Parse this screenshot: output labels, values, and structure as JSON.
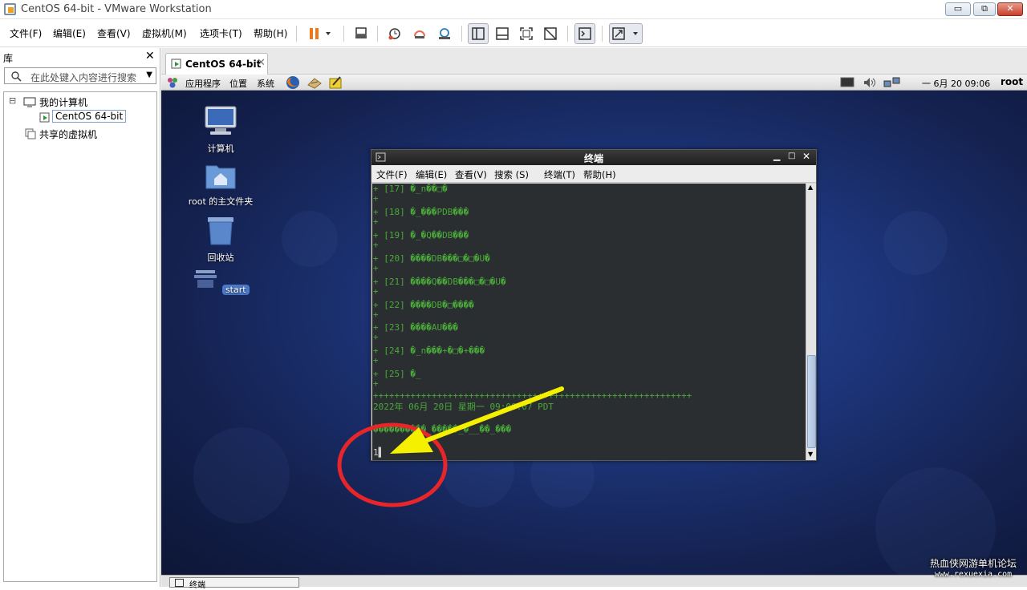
{
  "window": {
    "title": "CentOS 64-bit - VMware Workstation",
    "min_label": "▭",
    "max_label": "⧉",
    "close_label": "✕"
  },
  "menubar": {
    "items": [
      "文件(F)",
      "编辑(E)",
      "查看(V)",
      "虚拟机(M)",
      "选项卡(T)",
      "帮助(H)"
    ]
  },
  "library": {
    "header": "库",
    "close_label": "✕",
    "search_placeholder": "在此处键入内容进行搜索",
    "tree": {
      "my_computer": "我的计算机",
      "vm": "CentOS 64-bit",
      "shared": "共享的虚拟机",
      "expand_glyph": "⊟"
    }
  },
  "tab": {
    "label": "CentOS 64-bit",
    "close": "✕"
  },
  "gnome_panel": {
    "menus": [
      "应用程序",
      "位置",
      "系统"
    ],
    "clock": "一 6月 20 09:06",
    "user": "root"
  },
  "desktop": {
    "icons": [
      "计算机",
      "root 的主文件夹",
      "回收站",
      "start"
    ]
  },
  "terminal": {
    "title": "终端",
    "menus": [
      "文件(F)",
      "编辑(E)",
      "查看(V)",
      "搜索 (S)",
      "终端(T)",
      "帮助(H)"
    ],
    "lines": [
      "+ [17] �_n��□�",
      "+",
      "+ [18] �_���PDB���",
      "+",
      "+ [19] �_�Q��DB���",
      "+",
      "+ [20] ����DB���□�□�U�",
      "+",
      "+ [21] ����Q��DB���□�□�U�",
      "+",
      "+ [22] ����DB�□����",
      "+",
      "+ [23] ����AU���",
      "+",
      "+ [24] �_n���+�□�+���",
      "+",
      "+ [25] �_",
      "+",
      "++++++++++++++++++++++++++++++++++++++++++++++++++++++++++++",
      "2022年 06月 20日 星期一 09:06:07 PDT",
      "",
      "����������_�����_�__��_���",
      "",
      "1▌"
    ]
  },
  "taskbar": {
    "window_label": "终端"
  },
  "watermark": {
    "text": "热血侠网游单机论坛",
    "url": "www.rexuexia.com"
  },
  "colors": {
    "terminal_text": "#4aa83a",
    "terminal_bg": "#2a2e31",
    "annotation_arrow": "#f5f000",
    "annotation_circle": "#e8262a",
    "desktop_bg": "#1d357a"
  }
}
